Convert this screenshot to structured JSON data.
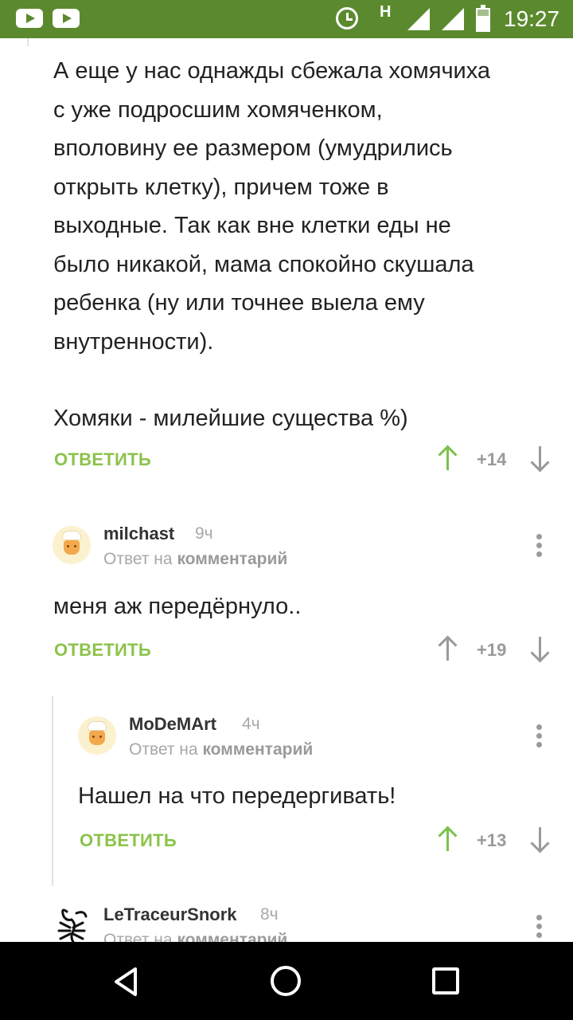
{
  "status_bar": {
    "network": "H",
    "time": "19:27",
    "icons": [
      "youtube-icon",
      "youtube-icon",
      "alarm-icon",
      "network-h-icon",
      "signal-icon",
      "signal-icon",
      "battery-charging-icon"
    ],
    "background_color": "#5b8a2e"
  },
  "comments": [
    {
      "paragraphs": [
        [
          "А еще у нас однажды сбежала хомячиха",
          "с уже подросшим хомяченком,",
          "вполовину ее размером (умудрились",
          "открыть клетку), причем тоже в",
          "выходные. Так как вне клетки еды не",
          "было никакой, мама спокойно скушала",
          "ребенка (ну или точнее выела ему",
          "внутренности)."
        ],
        [
          "Хомяки - милейшие существа %)"
        ]
      ],
      "reply_label": "ОТВЕТИТЬ",
      "score": "+14",
      "upvoted": true
    },
    {
      "author": "milchast",
      "time": "9ч",
      "reply_prefix": "Ответ на",
      "reply_link": "комментарий",
      "text": "меня аж передёрнуло..",
      "reply_label": "ОТВЕТИТЬ",
      "score": "+19",
      "upvoted": false
    },
    {
      "author": "MoDeMArt",
      "time": "4ч",
      "reply_prefix": "Ответ на",
      "reply_link": "комментарий",
      "text": "Нашел на что передергивать!",
      "reply_label": "ОТВЕТИТЬ",
      "score": "+13",
      "upvoted": true
    },
    {
      "author": "LeTraceurSnork",
      "time": "8ч",
      "reply_prefix": "Ответ на",
      "reply_link": "комментарий"
    }
  ],
  "colors": {
    "accent_green": "#8bc34a",
    "upvote_green": "#7cc04c",
    "muted_gray": "#9a9a9a"
  },
  "nav_bar": {
    "icons": [
      "back-icon",
      "home-icon",
      "recents-icon"
    ]
  }
}
